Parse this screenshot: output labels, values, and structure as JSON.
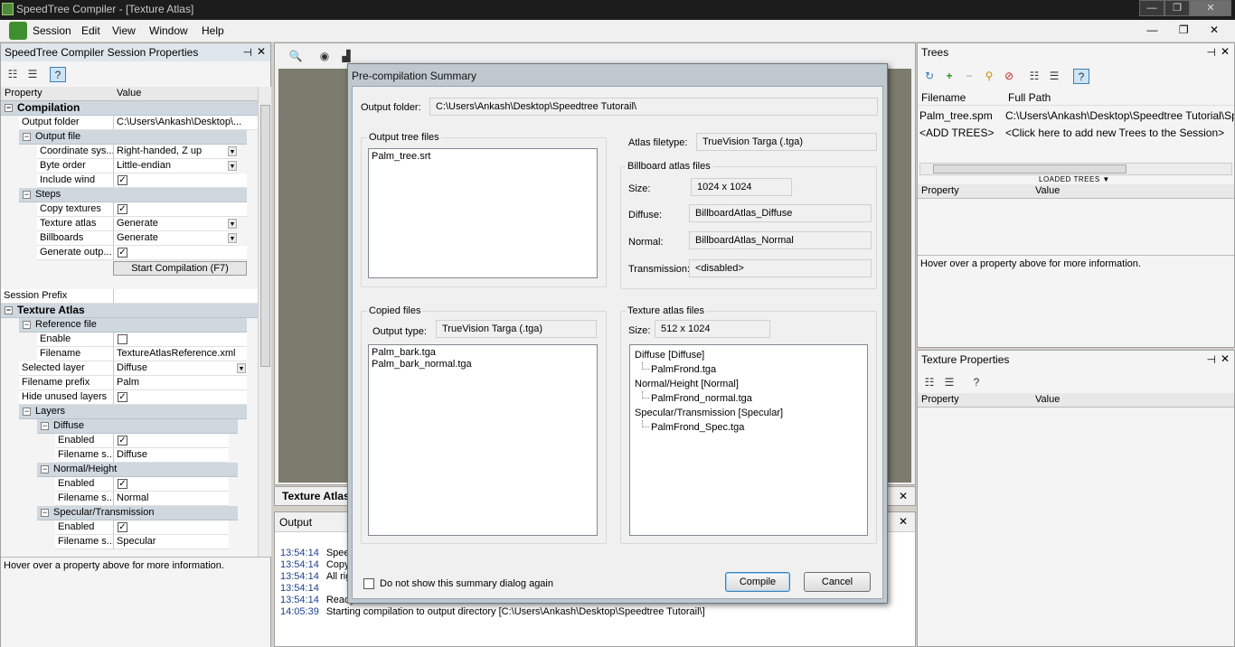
{
  "window": {
    "title": "SpeedTree Compiler - [Texture Atlas]",
    "min": "—",
    "max": "❐",
    "close": "✕"
  },
  "menu": [
    "Session",
    "Edit",
    "View",
    "Window",
    "Help"
  ],
  "mdi_controls": "— ❐ ✕",
  "session_panel": {
    "title": "SpeedTree Compiler Session Properties",
    "col_property": "Property",
    "col_value": "Value",
    "compilation": "Compilation",
    "output_folder_label": "Output folder",
    "output_folder_value": "C:\\Users\\Ankash\\Desktop\\...",
    "output_file": "Output file",
    "coord_label": "Coordinate sys...",
    "coord_value": "Right-handed, Z up",
    "byte_order_label": "Byte order",
    "byte_order_value": "Little-endian",
    "include_wind_label": "Include wind",
    "steps": "Steps",
    "copy_textures_label": "Copy textures",
    "texture_atlas_label": "Texture atlas",
    "texture_atlas_value": "Generate",
    "billboards_label": "Billboards",
    "billboards_value": "Generate",
    "generate_output_label": "Generate outp...",
    "start_compilation": "Start Compilation (F7)",
    "session_prefix_label": "Session Prefix",
    "texture_atlas_cat": "Texture Atlas",
    "reference_file": "Reference file",
    "enable_label": "Enable",
    "filename_label": "Filename",
    "filename_value": "TextureAtlasReference.xml",
    "selected_layer_label": "Selected layer",
    "selected_layer_value": "Diffuse",
    "filename_prefix_label": "Filename prefix",
    "filename_prefix_value": "Palm",
    "hide_unused_label": "Hide unused layers",
    "layers": "Layers",
    "diffuse": "Diffuse",
    "enabled_label": "Enabled",
    "filename_s_label": "Filename s...",
    "diffuse_value": "Diffuse",
    "normal_height": "Normal/Height",
    "normal_value": "Normal",
    "specular_transmission": "Specular/Transmission",
    "specular_value": "Specular",
    "hint": "Hover over a property above for more information."
  },
  "viewport": {
    "texture_atlas_tab": "Texture Atlas",
    "output_title": "Output"
  },
  "output_lines": [
    {
      "ts": "13:54:14",
      "msg": "Spee"
    },
    {
      "ts": "13:54:14",
      "msg": "Copy"
    },
    {
      "ts": "13:54:14",
      "msg": "All rig"
    },
    {
      "ts": "13:54:14",
      "msg": ""
    },
    {
      "ts": "13:54:14",
      "msg": "Ready"
    },
    {
      "ts": "14:05:39",
      "msg": "Starting compilation to output directory [C:\\Users\\Ankash\\Desktop\\Speedtree Tutorail\\]"
    }
  ],
  "dialog": {
    "title": "Pre-compilation Summary",
    "output_folder_label": "Output folder:",
    "output_folder_value": "C:\\Users\\Ankash\\Desktop\\Speedtree Tutorail\\",
    "output_tree_files": "Output tree files",
    "tree_files": [
      "Palm_tree.srt"
    ],
    "atlas_filetype_label": "Atlas filetype:",
    "atlas_filetype_value": "TrueVision Targa (.tga)",
    "billboard_atlas_files": "Billboard atlas files",
    "size_label": "Size:",
    "billboard_size": "1024 x 1024",
    "diffuse_label": "Diffuse:",
    "diffuse_value": "BillboardAtlas_Diffuse",
    "normal_label": "Normal:",
    "normal_value": "BillboardAtlas_Normal",
    "transmission_label": "Transmission:",
    "transmission_value": "<disabled>",
    "copied_files": "Copied files",
    "output_type_label": "Output type:",
    "output_type_value": "TrueVision Targa (.tga)",
    "copied": [
      "Palm_bark.tga",
      "Palm_bark_normal.tga"
    ],
    "texture_atlas_files": "Texture atlas files",
    "atlas_size_label": "Size:",
    "atlas_size": "512 x 1024",
    "atlas_tree": {
      "diffuse": "Diffuse [Diffuse]",
      "diffuse_child": "PalmFrond.tga",
      "normal": "Normal/Height [Normal]",
      "normal_child": "PalmFrond_normal.tga",
      "specular": "Specular/Transmission [Specular]",
      "specular_child": "PalmFrond_Spec.tga"
    },
    "dont_show": "Do not show this summary dialog again",
    "compile": "Compile",
    "cancel": "Cancel"
  },
  "trees_panel": {
    "title": "Trees",
    "col_filename": "Filename",
    "col_fullpath": "Full Path",
    "rows": [
      {
        "filename": "Palm_tree.spm",
        "path": "C:\\Users\\Ankash\\Desktop\\Speedtree Tutorial\\Sp"
      },
      {
        "filename": "<ADD TREES>",
        "path": "<Click here to add new Trees to the Session>"
      }
    ],
    "loaded_trees": "LOADED TREES",
    "col_property": "Property",
    "col_value": "Value",
    "hint": "Hover over a property above for more information."
  },
  "texture_panel": {
    "title": "Texture Properties",
    "col_property": "Property",
    "col_value": "Value"
  }
}
